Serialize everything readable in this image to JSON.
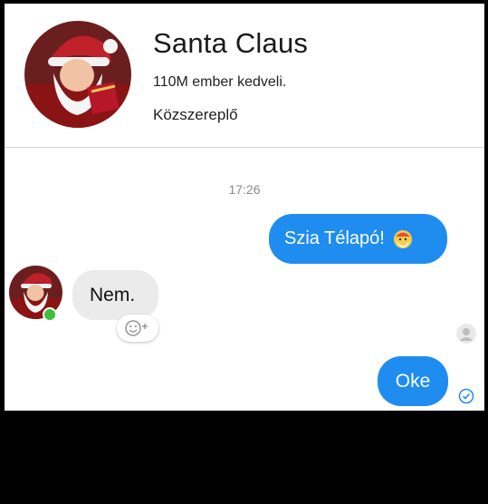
{
  "header": {
    "page_name": "Santa Claus",
    "likes_text": "110M ember kedveli.",
    "category": "Közszereplő",
    "avatar_icon": "santa-avatar-icon"
  },
  "conversation": {
    "timestamp": "17:26",
    "messages": [
      {
        "direction": "outgoing",
        "text": "Szia Télapó!",
        "emoji": "santa-face-emoji"
      },
      {
        "direction": "incoming",
        "text": "Nem."
      },
      {
        "direction": "outgoing",
        "text": "Oke"
      }
    ]
  },
  "colors": {
    "outgoing_bubble": "#1f8df0",
    "incoming_bubble": "#ebebeb",
    "online": "#3cc13b"
  }
}
